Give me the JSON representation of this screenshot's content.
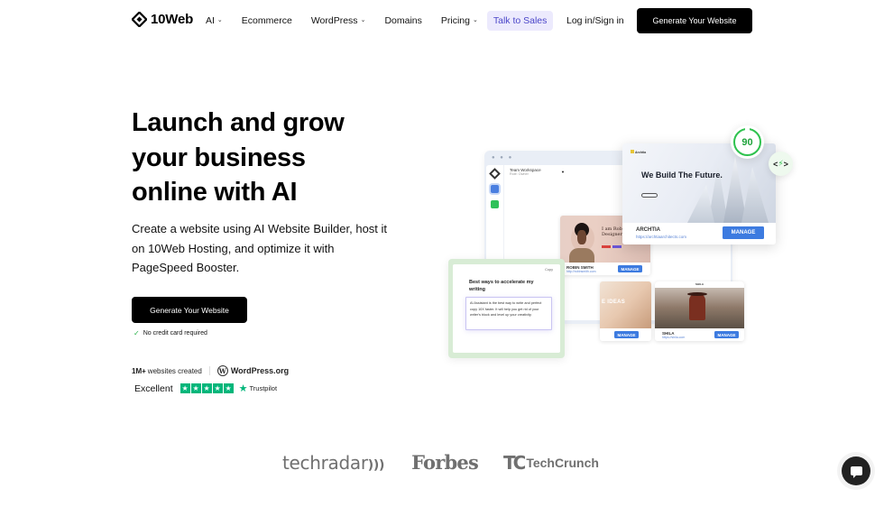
{
  "header": {
    "logo_text": "10Web",
    "nav": [
      {
        "label": "AI",
        "dropdown": true
      },
      {
        "label": "Ecommerce",
        "dropdown": false
      },
      {
        "label": "WordPress",
        "dropdown": true
      },
      {
        "label": "Domains",
        "dropdown": false
      },
      {
        "label": "Pricing",
        "dropdown": true
      }
    ],
    "talk_to_sales": "Talk to Sales",
    "login": "Log in/Sign in",
    "cta": "Generate Your Website"
  },
  "hero": {
    "title_lines": [
      "Launch and grow",
      "your business",
      "online with AI"
    ],
    "subtitle": "Create a website using AI Website Builder, host it on 10Web Hosting, and optimize it with PageSpeed Booster.",
    "cta": "Generate Your Website",
    "no_credit_card": "No credit card required",
    "stats_bold": "1M+",
    "stats_text": "websites created",
    "wordpress_label": "WordPress.org",
    "trust_rating": "Excellent",
    "trustpilot": "Trustpilot",
    "stars": 5
  },
  "illustration": {
    "workspace_name": "Team Workspace",
    "workspace_role": "Role: Owner",
    "robin": {
      "title": "I am Robin Product Designer",
      "name": "ROBIN SMITH",
      "url": "http://robinsmith.com",
      "manage": "MANAGE"
    },
    "archtia": {
      "brand": "Archtia",
      "headline": "We Build The Future.",
      "name": "ARCHTIA",
      "url": "https://archtiaarchitects.com",
      "manage": "MANAGE"
    },
    "ideas": {
      "label": "E IDEAS",
      "manage": "MANAGE"
    },
    "shila": {
      "brand": "SHILA",
      "name": "SHILA",
      "url": "https://shila.com",
      "manage": "MANAGE"
    },
    "ai_card": {
      "copy": "Copy",
      "title": "Best ways to accelerate my writing",
      "body": "AI Assistant is the best way to write and perfect copy 10X faster. It will help you get rid of your writer's block and level up your creativity."
    },
    "pagespeed_score": "90",
    "speed_icon": "lightning-code-icon"
  },
  "press": {
    "techradar": "techradar",
    "forbes": "Forbes",
    "techcrunch_mark": "TC",
    "techcrunch": "TechCrunch"
  },
  "colors": {
    "primary_button": "#000000",
    "talk_bg": "#eceafd",
    "talk_text": "#4b46c9",
    "trustpilot_green": "#00b67a",
    "score_green": "#2fc24f",
    "manage_blue": "#3d7be0"
  }
}
